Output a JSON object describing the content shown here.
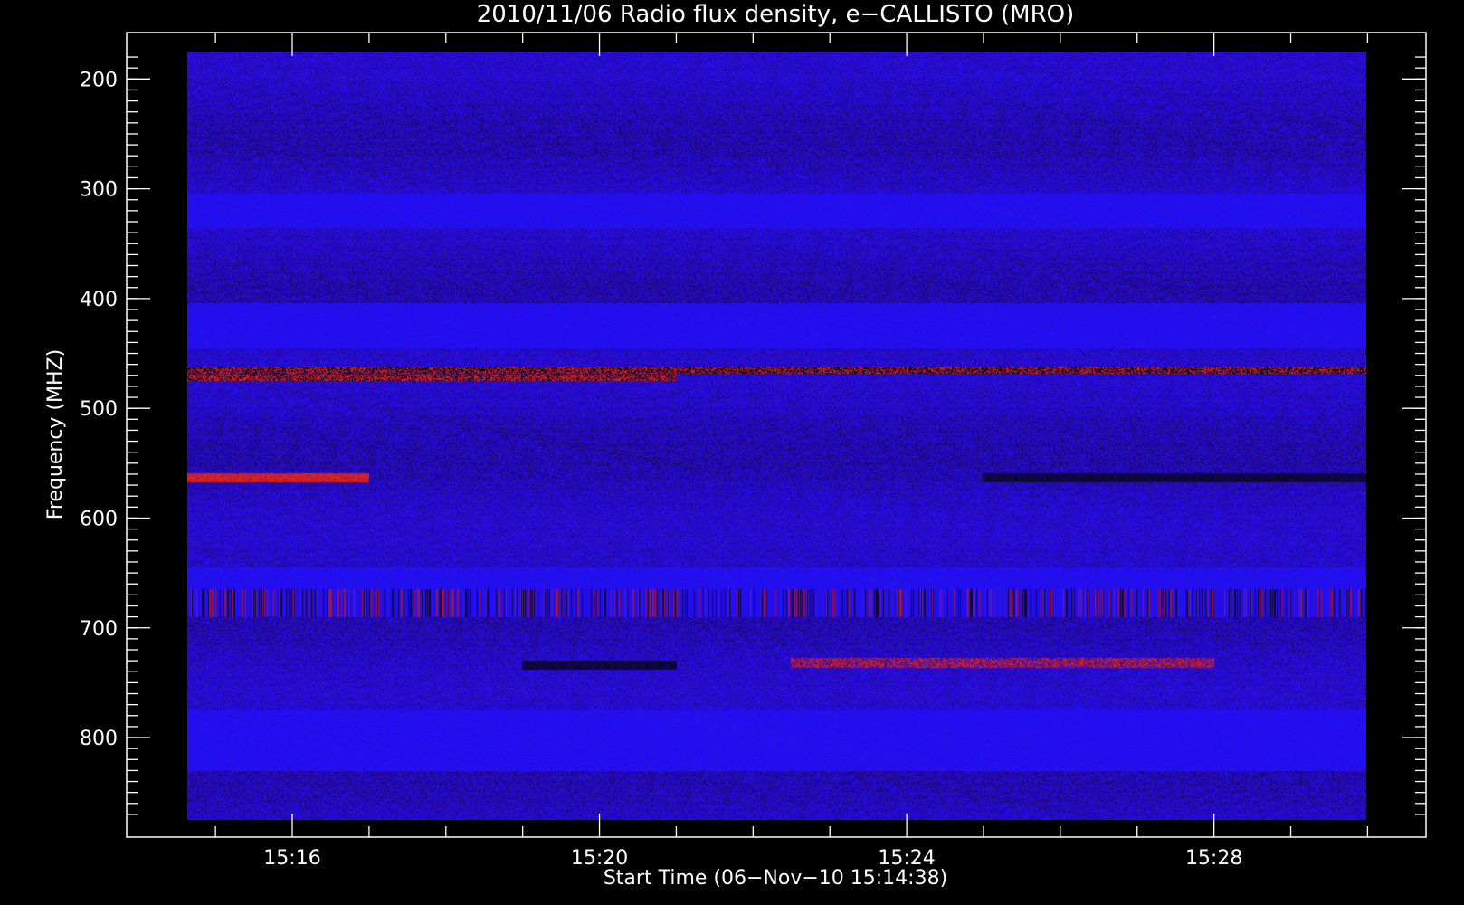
{
  "chart_data": {
    "type": "heatmap",
    "title": "2010/11/06  Radio flux density, e−CALLISTO (MRO)",
    "xlabel": "Start Time (06−Nov−10 15:14:38)",
    "ylabel": "Frequency (MHZ)",
    "colormap": [
      "#05051a",
      "#2a08a0",
      "#1f10ff",
      "#7a1060",
      "#ff2a00"
    ],
    "background_color": "#000000",
    "axis_color": "#ffffff",
    "x_range": [
      "15:14:38",
      "15:29:59"
    ],
    "y_range": [
      175,
      875
    ],
    "y_direction": "inverted",
    "x_ticks": [
      {
        "label": "15:16",
        "value": "15:16"
      },
      {
        "label": "15:20",
        "value": "15:20"
      },
      {
        "label": "15:24",
        "value": "15:24"
      },
      {
        "label": "15:28",
        "value": "15:28"
      }
    ],
    "x_minor_ticks": [
      "15:15",
      "15:17",
      "15:18",
      "15:19",
      "15:21",
      "15:22",
      "15:23",
      "15:25",
      "15:26",
      "15:27",
      "15:29",
      "15:30"
    ],
    "y_ticks": [
      {
        "label": "200",
        "value": 200
      },
      {
        "label": "300",
        "value": 300
      },
      {
        "label": "400",
        "value": 400
      },
      {
        "label": "500",
        "value": 500
      },
      {
        "label": "600",
        "value": 600
      },
      {
        "label": "700",
        "value": 700
      },
      {
        "label": "800",
        "value": 800
      }
    ],
    "y_minor_step": 10,
    "features": [
      {
        "freq_mhz": [
          305,
          335
        ],
        "start": "15:14:38",
        "end": "15:30:00",
        "kind": "bright-blue band"
      },
      {
        "freq_mhz": [
          405,
          445
        ],
        "start": "15:14:38",
        "end": "15:30:00",
        "kind": "bright-blue band"
      },
      {
        "freq_mhz": [
          462,
          468
        ],
        "start": "15:14:38",
        "end": "15:30:00",
        "kind": "intermittent red/black line"
      },
      {
        "freq_mhz": [
          470,
          475
        ],
        "start": "15:14:38",
        "end": "15:21:00",
        "kind": "orange dashed line"
      },
      {
        "freq_mhz": [
          560,
          567
        ],
        "start": "15:14:38",
        "end": "15:17:00",
        "kind": "strong red emission"
      },
      {
        "freq_mhz": [
          560,
          567
        ],
        "start": "15:25:00",
        "end": "15:30:00",
        "kind": "dark absorption line"
      },
      {
        "freq_mhz": [
          645,
          665
        ],
        "start": "15:14:38",
        "end": "15:30:00",
        "kind": "bright-blue band"
      },
      {
        "freq_mhz": [
          665,
          690
        ],
        "start": "15:14:38",
        "end": "15:30:00",
        "kind": "vertical striping"
      },
      {
        "freq_mhz": [
          728,
          736
        ],
        "start": "15:22:30",
        "end": "15:28:00",
        "kind": "red emission"
      },
      {
        "freq_mhz": [
          730,
          738
        ],
        "start": "15:19:00",
        "end": "15:21:00",
        "kind": "dark line"
      },
      {
        "freq_mhz": [
          775,
          830
        ],
        "start": "15:14:38",
        "end": "15:30:00",
        "kind": "bright-blue band"
      }
    ]
  }
}
